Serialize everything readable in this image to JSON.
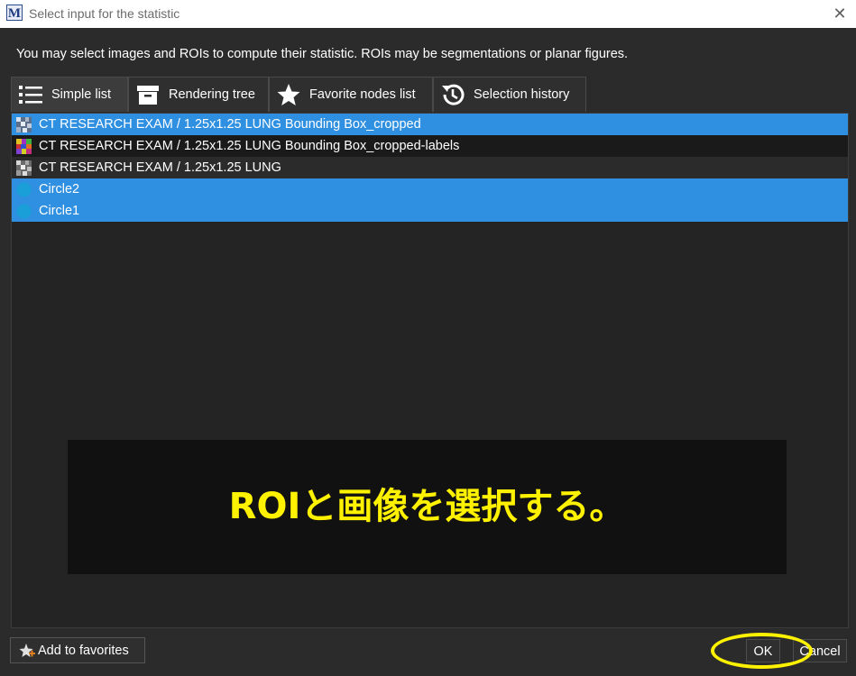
{
  "window": {
    "title": "Select input for the statistic",
    "app_icon": "mitk-app-icon",
    "close_icon": "close-icon"
  },
  "description": "You may select images and ROIs to compute their statistic. ROIs may be segmentations or planar figures.",
  "tabs": [
    {
      "label": "Simple list",
      "icon": "list-icon",
      "active": true
    },
    {
      "label": "Rendering tree",
      "icon": "archive-box-icon",
      "active": false
    },
    {
      "label": "Favorite nodes list",
      "icon": "star-icon",
      "active": false
    },
    {
      "label": "Selection history",
      "icon": "history-icon",
      "active": false
    }
  ],
  "items": [
    {
      "label": "CT RESEARCH EXAM / 1.25x1.25 LUNG Bounding Box_cropped",
      "icon": "image-icon",
      "selected": true
    },
    {
      "label": "CT RESEARCH EXAM / 1.25x1.25 LUNG Bounding Box_cropped-labels",
      "icon": "label-image-icon",
      "selected": false
    },
    {
      "label": "CT RESEARCH EXAM / 1.25x1.25 LUNG",
      "icon": "image-icon",
      "selected": false
    },
    {
      "label": "Circle2",
      "icon": "circle-icon",
      "selected": true
    },
    {
      "label": "Circle1",
      "icon": "circle-icon",
      "selected": true
    }
  ],
  "annotation": {
    "text": "ROIと画像を選択する。",
    "color": "#fff200"
  },
  "footer": {
    "add_favorites_label": "Add to favorites",
    "add_favorites_icon": "star-plus-icon",
    "ok_label": "OK",
    "cancel_label": "Cancel"
  },
  "colors": {
    "selection": "#2f8fe0",
    "background": "#2b2b2b",
    "highlight": "#fff200"
  }
}
